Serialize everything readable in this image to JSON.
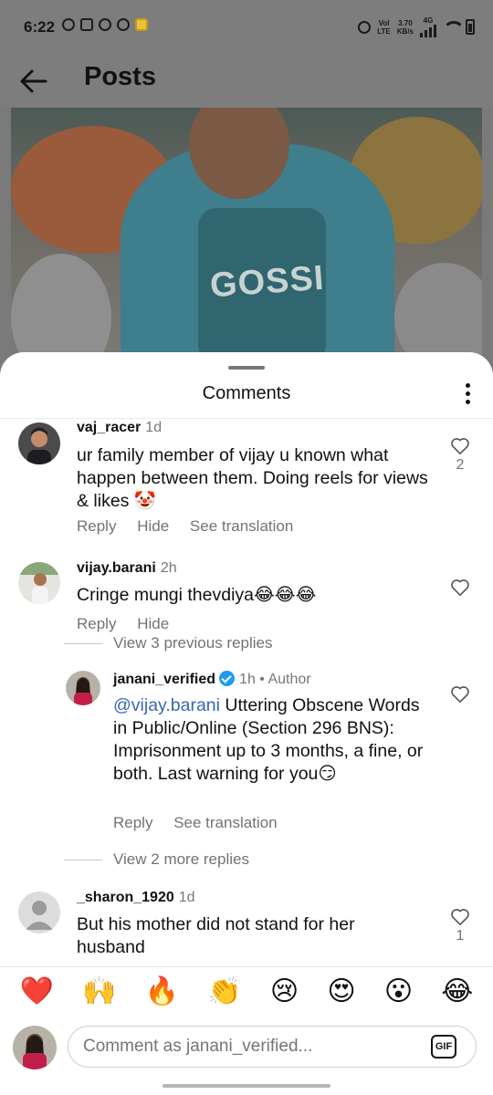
{
  "status_bar": {
    "time": "6:22",
    "net_label_top": "Vol",
    "net_label_bottom": "LTE",
    "speed_top": "3.70",
    "speed_bottom": "KB/s",
    "network": "4G"
  },
  "header": {
    "title": "Posts"
  },
  "media": {
    "shirt_text": "GOSSI"
  },
  "sheet": {
    "title": "Comments"
  },
  "comments": [
    {
      "username": "vaj_racer",
      "time": "1d",
      "text": "ur family member of vijay u known what happen between them. Doing reels for views & likes 🤡",
      "actions": [
        "Reply",
        "Hide",
        "See translation"
      ],
      "likes": "2"
    },
    {
      "username": "vijay.barani",
      "time": "2h",
      "text": "Cringe mungi thevdiya😂😂😂",
      "actions": [
        "Reply",
        "Hide"
      ],
      "likes": ""
    }
  ],
  "view_previous_replies": "View 3 previous replies",
  "reply": {
    "username": "janani_verified",
    "time": "1h",
    "author_tag": "• Author",
    "mention": "@vijay.barani",
    "text": " Uttering Obscene Words in Public/Online (Section 296 BNS): Imprisonment up to 3 months, a fine, or both. Last warning for you😏",
    "actions": [
      "Reply",
      "See translation"
    ]
  },
  "view_more_replies": "View 2 more replies",
  "comment3": {
    "username": "_sharon_1920",
    "time": "1d",
    "text": "But his mother did not stand for her husband",
    "likes": "1"
  },
  "emojis": [
    "❤️",
    "🙌",
    "🔥",
    "👏",
    "😢",
    "😍",
    "😮",
    "😂"
  ],
  "composer": {
    "placeholder": "Comment as janani_verified...",
    "gif_label": "GIF"
  }
}
